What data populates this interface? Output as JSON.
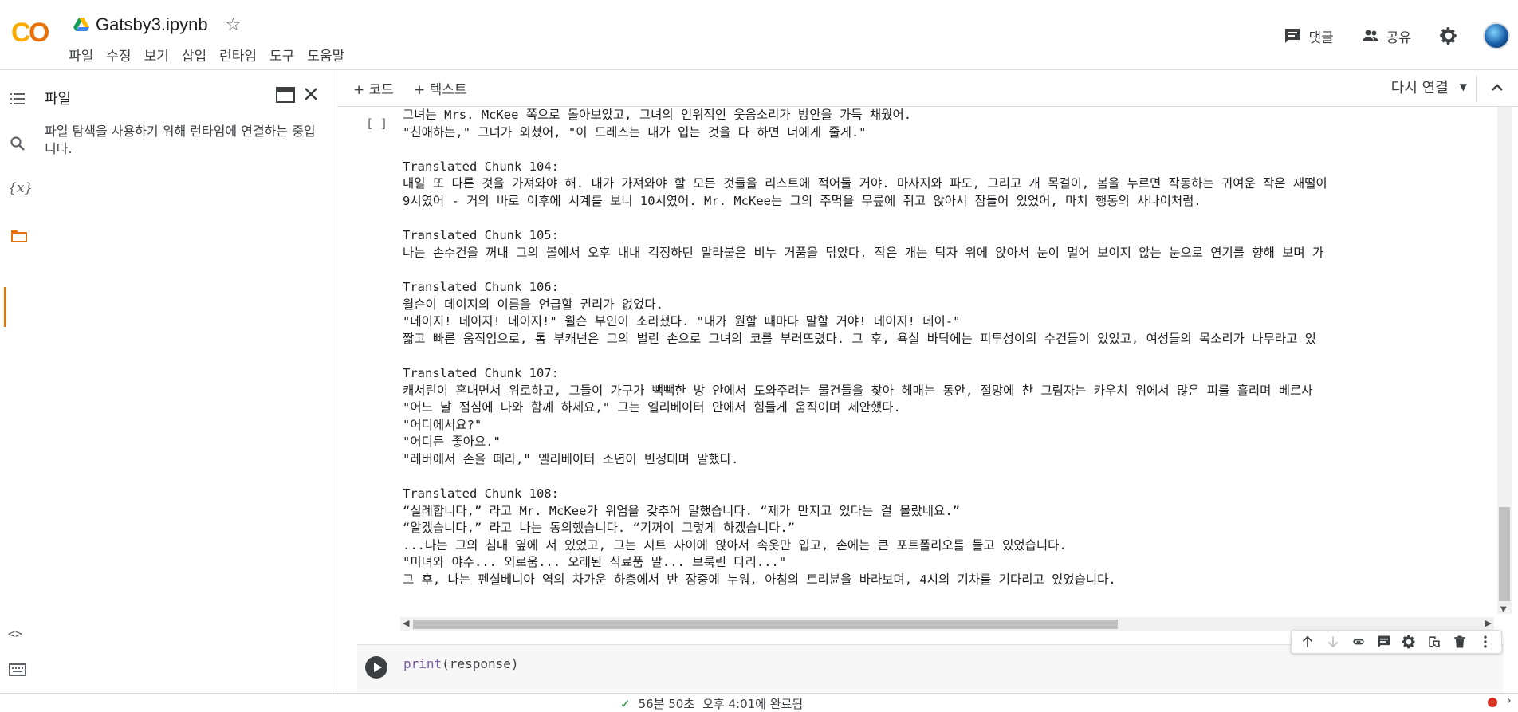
{
  "app": {
    "logo_text_c": "C",
    "logo_text_o": "O",
    "notebook_title": "Gatsby3.ipynb"
  },
  "menu": [
    "파일",
    "수정",
    "보기",
    "삽입",
    "런타임",
    "도구",
    "도움말"
  ],
  "header_right": {
    "comment_label": "댓글",
    "share_label": "공유"
  },
  "file_panel": {
    "title": "파일",
    "message": "파일 탐색을 사용하기 위해 런타임에 연결하는 중입니다."
  },
  "toolbar": {
    "add_code": "+ 코드",
    "add_text": "+ 텍스트",
    "reconnect": "다시 연결"
  },
  "cell": {
    "bracket": "[ ]",
    "output_lines": [
      "그녀는 Mrs. McKee 쪽으로 돌아보았고, 그녀의 인위적인 웃음소리가 방안을 가득 채웠어.",
      "\"친애하는,\" 그녀가 외쳤어, \"이 드레스는 내가 입는 것을 다 하면 너에게 줄게.\"",
      "",
      "Translated Chunk 104:",
      "내일 또 다른 것을 가져와야 해. 내가 가져와야 할 모든 것들을 리스트에 적어둘 거야. 마사지와 파도, 그리고 개 목걸이, 봄을 누르면 작동하는 귀여운 작은 재떨이",
      "9시였어 - 거의 바로 이후에 시계를 보니 10시였어. Mr. McKee는 그의 주먹을 무릎에 쥐고 앉아서 잠들어 있었어, 마치 행동의 사나이처럼.",
      "",
      "Translated Chunk 105:",
      "나는 손수건을 꺼내 그의 볼에서 오후 내내 걱정하던 말라붙은 비누 거품을 닦았다. 작은 개는 탁자 위에 앉아서 눈이 멀어 보이지 않는 눈으로 연기를 향해 보며 가",
      "",
      "Translated Chunk 106:",
      "윌슨이 데이지의 이름을 언급할 권리가 없었다.",
      "\"데이지! 데이지! 데이지!\" 윌슨 부인이 소리쳤다. \"내가 원할 때마다 말할 거야! 데이지! 데이-\"",
      "짧고 빠른 움직임으로, 톰 부캐넌은 그의 벌린 손으로 그녀의 코를 부러뜨렸다. 그 후, 욕실 바닥에는 피투성이의 수건들이 있었고, 여성들의 목소리가 나무라고 있",
      "",
      "Translated Chunk 107:",
      "캐서린이 혼내면서 위로하고, 그들이 가구가 빽빽한 방 안에서 도와주려는 물건들을 찾아 헤매는 동안, 절망에 찬 그림자는 카우치 위에서 많은 피를 흘리며 베르사",
      "\"어느 날 점심에 나와 함께 하세요,\" 그는 엘리베이터 안에서 힘들게 움직이며 제안했다.",
      "\"어디에서요?\"",
      "\"어디든 좋아요.\"",
      "\"레버에서 손을 떼라,\" 엘리베이터 소년이 빈정대며 말했다.",
      "",
      "Translated Chunk 108:",
      "“실례합니다,” 라고 Mr. McKee가 위엄을 갖추어 말했습니다. “제가 만지고 있다는 걸 몰랐네요.”",
      "“알겠습니다,” 라고 나는 동의했습니다. “기꺼이 그렇게 하겠습니다.”",
      "...나는 그의 침대 옆에 서 있었고, 그는 시트 사이에 앉아서 속옷만 입고, 손에는 큰 포트폴리오를 들고 있었습니다.",
      "\"미녀와 야수... 외로움... 오래된 식료품 말... 브룩린 다리...\"",
      "그 후, 나는 펜실베니아 역의 차가운 하층에서 반 잠중에 누워, 아침의 트리뷴을 바라보며, 4시의 기차를 기다리고 있었습니다."
    ]
  },
  "code_cell": {
    "func": "print",
    "rest": "(response)"
  },
  "status": {
    "check": "✓",
    "duration": "56분 50초",
    "completed": "오후 4:01에 완료됨"
  },
  "colors": {
    "accent_orange": "#e8710a",
    "logo_yellow": "#f9ab00",
    "status_red": "#d93025",
    "check_green": "#188038"
  }
}
